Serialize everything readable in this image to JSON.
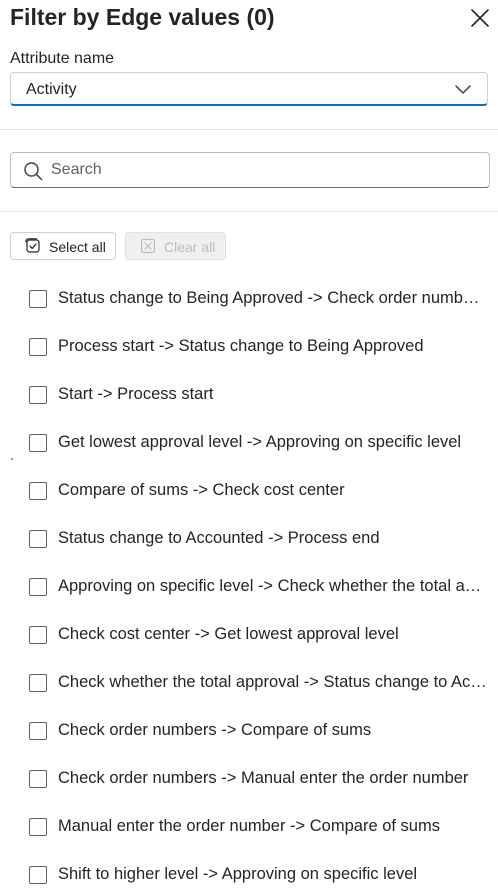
{
  "header": {
    "title": "Filter by Edge values (0)"
  },
  "attribute": {
    "label": "Attribute name",
    "selected": "Activity"
  },
  "search": {
    "placeholder": "Search",
    "value": ""
  },
  "actions": {
    "select_all_label": "Select all",
    "clear_all_label": "Clear all",
    "clear_all_enabled": false
  },
  "items": [
    {
      "label": "Status change to Being Approved -> Check order numbe…",
      "checked": false
    },
    {
      "label": "Process start -> Status change to Being Approved",
      "checked": false
    },
    {
      "label": "Start -> Process start",
      "checked": false
    },
    {
      "label": "Get lowest approval level -> Approving on specific level",
      "checked": false
    },
    {
      "label": "Compare of sums -> Check cost center",
      "checked": false
    },
    {
      "label": "Status change to Accounted -> Process end",
      "checked": false
    },
    {
      "label": "Approving on specific level -> Check whether the total a…",
      "checked": false
    },
    {
      "label": "Check cost center -> Get lowest approval level",
      "checked": false
    },
    {
      "label": "Check whether the total approval -> Status change to Ac…",
      "checked": false
    },
    {
      "label": "Check order numbers -> Compare of sums",
      "checked": false
    },
    {
      "label": "Check order numbers -> Manual enter the order number",
      "checked": false
    },
    {
      "label": "Manual enter the order number -> Compare of sums",
      "checked": false
    },
    {
      "label": "Shift to higher level -> Approving on specific level",
      "checked": false
    }
  ],
  "colors": {
    "accent": "#0f6cbd",
    "text": "#242424",
    "disabled": "#bdbdbd"
  }
}
